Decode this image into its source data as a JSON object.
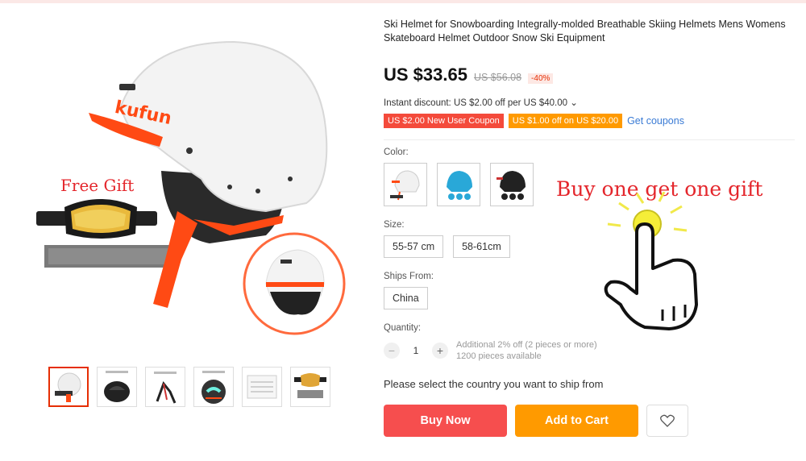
{
  "product": {
    "title": "Ski Helmet for Snowboarding Integrally-molded Breathable Skiing Helmets Mens Womens Skateboard Helmet Outdoor Snow Ski Equipment",
    "brand_logo_text": "kufun",
    "gift_caption": "Free Gift",
    "promo_caption": "Buy one get one gift"
  },
  "price": {
    "current": "US $33.65",
    "original": "US $56.08",
    "discount": "-40%"
  },
  "instant_discount": "Instant discount: US $2.00 off per US $40.00 ⌄",
  "coupons": [
    {
      "label": "US $2.00 New User Coupon",
      "color": "#f44a3b"
    },
    {
      "label": "US $1.00 off on US $20.00",
      "color": "#ff9a00"
    }
  ],
  "get_coupons": "Get coupons",
  "color": {
    "label": "Color:",
    "options": [
      "white",
      "blue",
      "black"
    ]
  },
  "size": {
    "label": "Size:",
    "options": [
      "55-57 cm",
      "58-61cm"
    ]
  },
  "ships_from": {
    "label": "Ships From:",
    "options": [
      "China"
    ]
  },
  "quantity": {
    "label": "Quantity:",
    "value": "1",
    "minus": "−",
    "plus": "+",
    "note1": "Additional 2% off (2 pieces or more)",
    "note2": "1200 pieces available"
  },
  "ship_message": "Please select the country you want to ship from",
  "buttons": {
    "buy_now": "Buy Now",
    "add_to_cart": "Add to Cart"
  },
  "thumbnails": 6,
  "accent_color": "#e62e04",
  "icons": [
    "heart-icon",
    "chevron-down-icon"
  ]
}
